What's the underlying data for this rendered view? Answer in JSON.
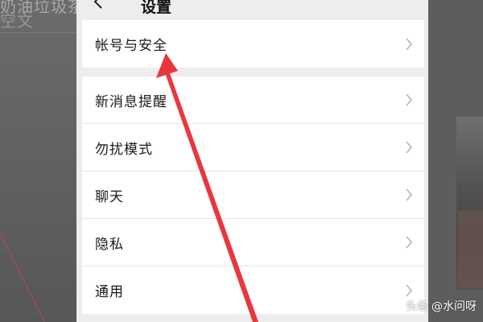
{
  "background_app": {
    "left_text": "奶油垃圾茶白",
    "left_text2": "空文"
  },
  "header": {
    "title": "设置"
  },
  "groups": [
    {
      "items": [
        {
          "label": "帐号与安全"
        }
      ]
    },
    {
      "items": [
        {
          "label": "新消息提醒"
        },
        {
          "label": "勿扰模式"
        },
        {
          "label": "聊天"
        },
        {
          "label": "隐私"
        },
        {
          "label": "通用"
        }
      ]
    }
  ],
  "watermark": {
    "brand": "头条",
    "handle": "@水问呀"
  },
  "colors": {
    "annotation_red": "#e8383d",
    "panel_bg": "#ededed",
    "row_bg": "#ffffff",
    "dim_bg": "#5a5a5a"
  },
  "icons": {
    "back": "chevron-left-icon",
    "row_arrow": "chevron-right-icon"
  }
}
